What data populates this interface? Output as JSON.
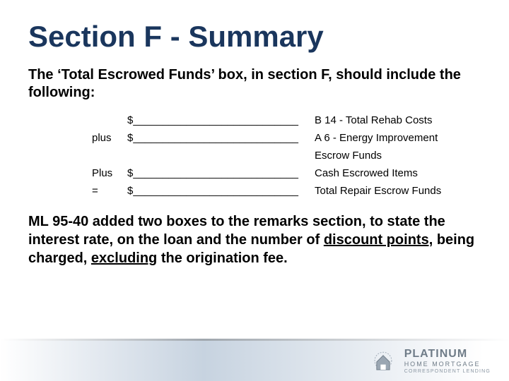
{
  "title": "Section F - Summary",
  "intro": "The ‘Total Escrowed Funds’ box, in section F, should include the following:",
  "rows": [
    {
      "op": "",
      "amount": "$____________________________",
      "desc": "B 14 - Total Rehab Costs"
    },
    {
      "op": "plus",
      "amount": "$____________________________",
      "desc": "A 6 - Energy Improvement"
    },
    {
      "op": "",
      "amount": "",
      "desc": "Escrow Funds"
    },
    {
      "op": "Plus",
      "amount": "$____________________________",
      "desc": "Cash Escrowed Items"
    },
    {
      "op": "=",
      "amount": "$____________________________",
      "desc": "Total Repair Escrow Funds"
    }
  ],
  "closing": {
    "pre": "ML 95-40 added two boxes to the remarks section, to state the interest rate, on the loan and the number of ",
    "u1": "discount points,",
    "mid": " being charged, ",
    "u2": "excluding",
    "post": " the origination fee."
  },
  "logo": {
    "line1": "PLATINUM",
    "line2": "HOME MORTGAGE",
    "line3": "CORRESPONDENT LENDING"
  }
}
